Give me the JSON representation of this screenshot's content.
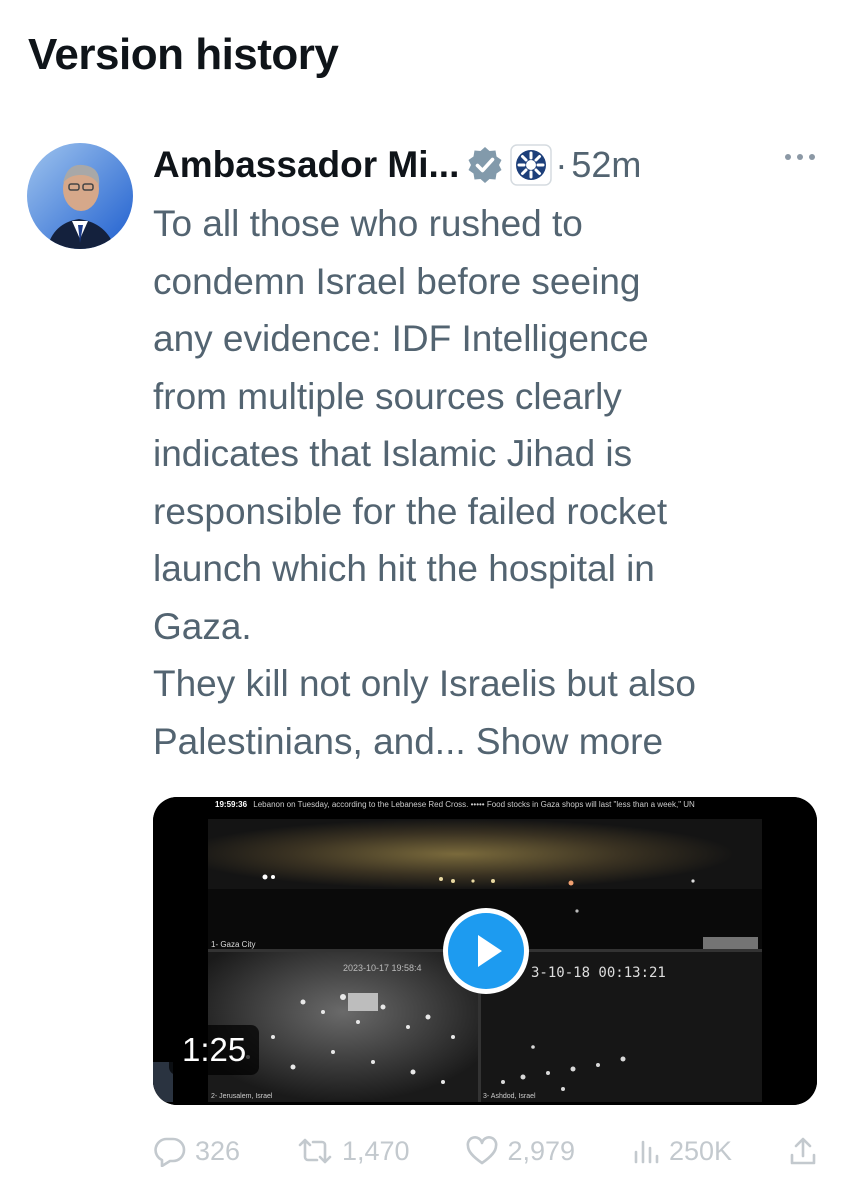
{
  "page": {
    "title": "Version history"
  },
  "tweet": {
    "author_name": "Ambassador Mi...",
    "time": "52m",
    "separator": "·",
    "text": "To all those who rushed to\ncondemn Israel before seeing\nany evidence: IDF Intelligence\nfrom multiple sources clearly\nindicates that Islamic Jihad is\nresponsible for the failed rocket\nlaunch which hit the hospital in\nGaza.\nThey kill not only Israelis but also\nPalestinians, and...",
    "show_more": " Show more"
  },
  "media": {
    "duration": "1:25",
    "ticker_time": "19:59:36",
    "ticker_text": "Lebanon on Tuesday, according to the Lebanese Red Cross. ••••• Food stocks in Gaza shops will last \"less than a week,\" UN",
    "label_top": "1- Gaza City",
    "label_bottom_left": "2- Jerusalem, Israel",
    "label_bottom_right": "3- Ashdod, Israel",
    "timestamp_left": "2023-10-17 19:58:4",
    "timestamp_right": "3-10-18 00:13:21"
  },
  "actions": {
    "replies": "326",
    "reposts": "1,470",
    "likes": "2,979",
    "views": "250K"
  },
  "colors": {
    "text_primary": "#0f1419",
    "text_secondary": "#536471",
    "verified_gray": "#829aab",
    "play_blue": "#1d9bf0",
    "faded_icons": "#c3c9ce"
  }
}
